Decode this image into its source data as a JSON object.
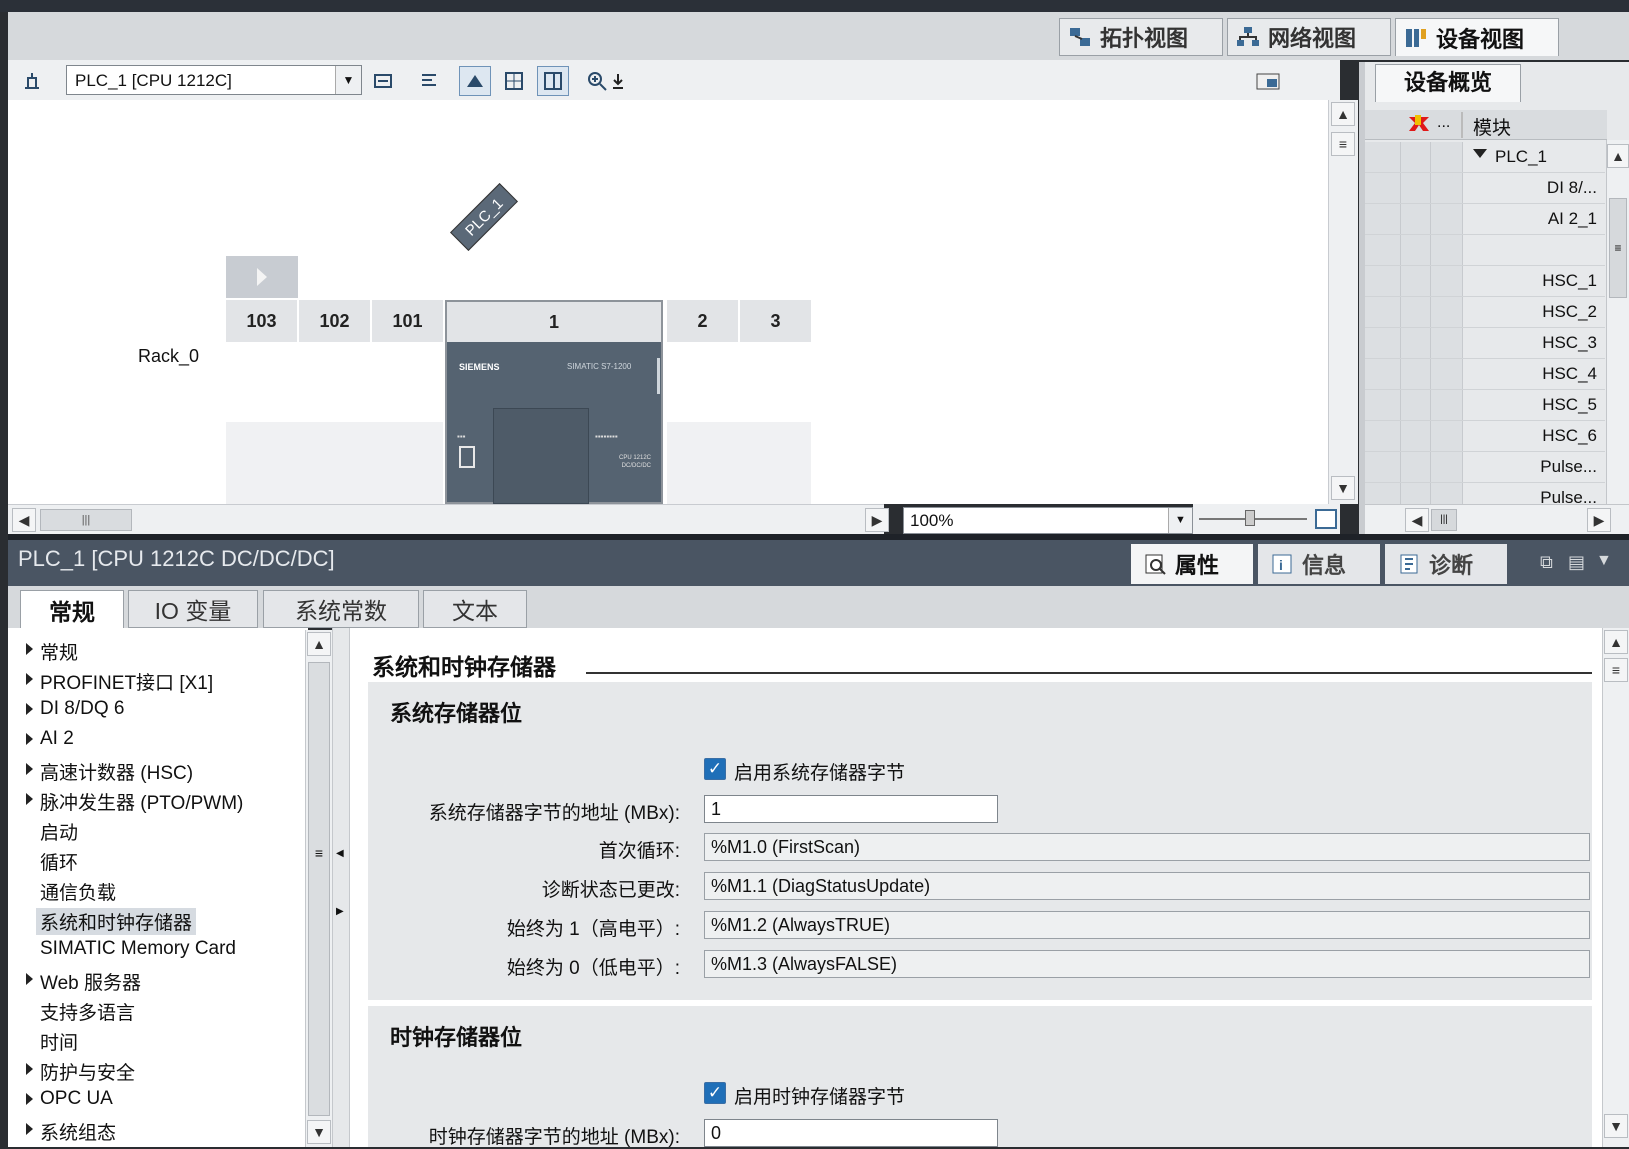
{
  "view_tabs": {
    "topology": "拓扑视图",
    "network": "网络视图",
    "device": "设备视图"
  },
  "toolbar": {
    "device_select": "PLC_1 [CPU 1212C]",
    "zoom": "100%"
  },
  "canvas": {
    "plc_label": "PLC_1",
    "rack_label": "Rack_0",
    "slots": [
      "103",
      "102",
      "101",
      "1",
      "2",
      "3"
    ],
    "cpu_brand": "SIEMENS",
    "cpu_model_small": "SIMATIC S7-1200",
    "cpu_code": "CPU 1212C DC/DC/DC"
  },
  "overview": {
    "tab": "设备概览",
    "col_more": "...",
    "col_module": "模块",
    "rows": [
      "PLC_1",
      "DI 8/...",
      "AI 2_1",
      "",
      "HSC_1",
      "HSC_2",
      "HSC_3",
      "HSC_4",
      "HSC_5",
      "HSC_6",
      "Pulse...",
      "Pulse..."
    ]
  },
  "inspector": {
    "title": "PLC_1 [CPU 1212C DC/DC/DC]",
    "tabs": {
      "properties": "属性",
      "info": "信息",
      "diagnostics": "诊断"
    }
  },
  "prop_tabs": [
    "常规",
    "IO 变量",
    "系统常数",
    "文本"
  ],
  "nav_tree": [
    {
      "label": "常规",
      "expandable": true
    },
    {
      "label": "PROFINET接口 [X1]",
      "expandable": true
    },
    {
      "label": "DI 8/DQ 6",
      "expandable": true
    },
    {
      "label": "AI 2",
      "expandable": true
    },
    {
      "label": "高速计数器 (HSC)",
      "expandable": true
    },
    {
      "label": "脉冲发生器 (PTO/PWM)",
      "expandable": true
    },
    {
      "label": "启动",
      "expandable": false
    },
    {
      "label": "循环",
      "expandable": false
    },
    {
      "label": "通信负载",
      "expandable": false
    },
    {
      "label": "系统和时钟存储器",
      "expandable": false,
      "selected": true
    },
    {
      "label": "SIMATIC Memory Card",
      "expandable": false
    },
    {
      "label": "Web 服务器",
      "expandable": true
    },
    {
      "label": "支持多语言",
      "expandable": false
    },
    {
      "label": "时间",
      "expandable": false
    },
    {
      "label": "防护与安全",
      "expandable": true
    },
    {
      "label": "OPC UA",
      "expandable": true
    },
    {
      "label": "系统组态",
      "expandable": true
    }
  ],
  "content": {
    "section_title": "系统和时钟存储器",
    "sys_group": {
      "title": "系统存储器位",
      "enable_label": "启用系统存储器字节",
      "enabled": true,
      "fields": [
        {
          "label": "系统存储器字节的地址 (MBx):",
          "value": "1",
          "editable": true
        },
        {
          "label": "首次循环:",
          "value": "%M1.0 (FirstScan)",
          "editable": false
        },
        {
          "label": "诊断状态已更改:",
          "value": "%M1.1 (DiagStatusUpdate)",
          "editable": false
        },
        {
          "label": "始终为 1（高电平）:",
          "value": "%M1.2 (AlwaysTRUE)",
          "editable": false
        },
        {
          "label": "始终为 0（低电平）:",
          "value": "%M1.3 (AlwaysFALSE)",
          "editable": false
        }
      ]
    },
    "clock_group": {
      "title": "时钟存储器位",
      "enable_label": "启用时钟存储器字节",
      "enabled": true,
      "address_label": "时钟存储器字节的地址 (MBx):",
      "address_value": "0"
    }
  },
  "colors": {
    "accent": "#1f6fb8",
    "inspector_bar": "#4a5563",
    "cpu_body": "#556371"
  }
}
